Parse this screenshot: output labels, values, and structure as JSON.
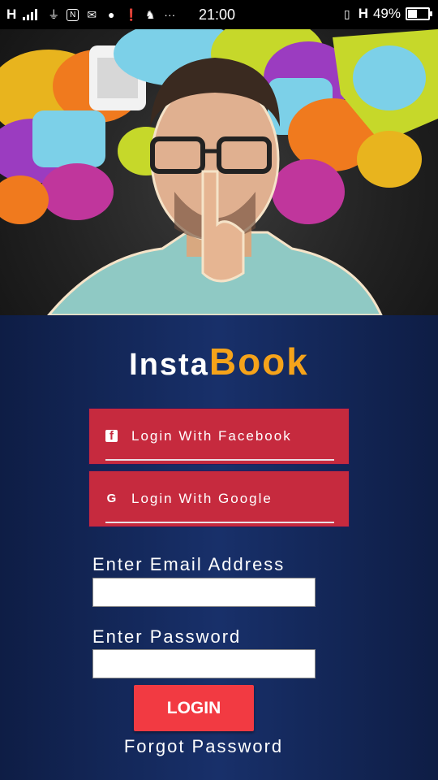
{
  "status_bar": {
    "carrier": "H",
    "time": "21:00",
    "network": "H",
    "battery": "49%",
    "battery_level": 0.49,
    "icons": [
      "signal-icon",
      "usb-icon",
      "nfc-icon",
      "mail-icon",
      "chat-icon",
      "alert-icon",
      "android-icon",
      "more-icon",
      "vibrate-icon",
      "battery-icon"
    ]
  },
  "hero": {
    "image": "man-shushing-illustration"
  },
  "brand": {
    "part1": "Insta",
    "part2": "Book"
  },
  "buttons": {
    "facebook_label": "Login With Facebook",
    "google_label": "Login With Google",
    "login_label": "LOGIN"
  },
  "form": {
    "email_label": "Enter Email Address",
    "email_value": "",
    "password_label": "Enter Password",
    "password_value": ""
  },
  "links": {
    "forgot": "Forgot Password"
  },
  "colors": {
    "brand_accent": "#f5a31a",
    "button_red": "#c62a3e",
    "login_red": "#f23a42",
    "panel_blue": "#12275a"
  }
}
